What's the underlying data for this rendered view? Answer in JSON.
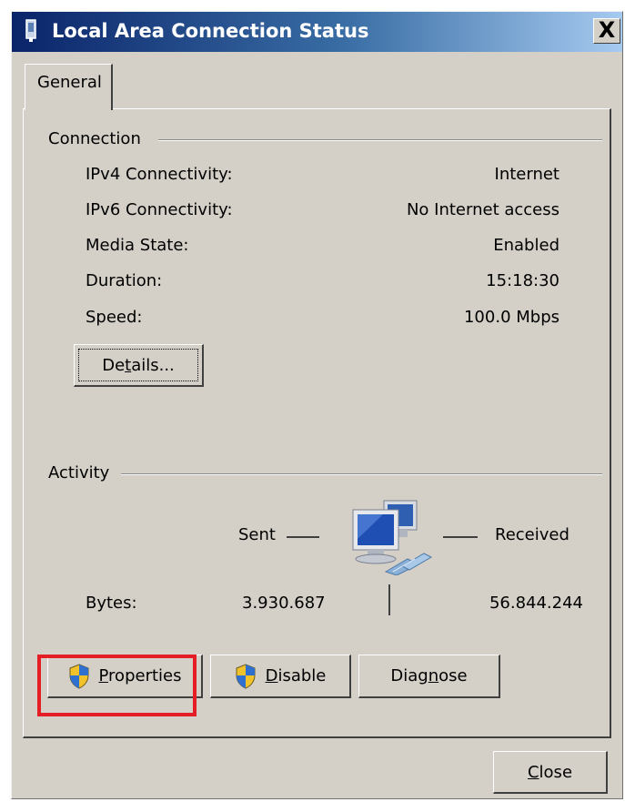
{
  "window": {
    "title": "Local Area Connection Status",
    "close_glyph": "X"
  },
  "tabs": [
    {
      "label": "General"
    }
  ],
  "connection": {
    "group_label": "Connection",
    "rows": [
      {
        "label": "IPv4 Connectivity:",
        "value": "Internet"
      },
      {
        "label": "IPv6 Connectivity:",
        "value": "No Internet access"
      },
      {
        "label": "Media State:",
        "value": "Enabled"
      },
      {
        "label": "Duration:",
        "value": "15:18:30"
      },
      {
        "label": "Speed:",
        "value": "100.0 Mbps"
      }
    ],
    "details_button": {
      "label_pre": "De",
      "label_mnemonic": "t",
      "label_post": "ails..."
    }
  },
  "activity": {
    "group_label": "Activity",
    "sent_label": "Sent",
    "received_label": "Received",
    "bytes_label": "Bytes:",
    "bytes_sent": "3.930.687",
    "bytes_received": "56.844.244"
  },
  "buttons": {
    "properties": {
      "mnemonic": "P",
      "rest": "roperties",
      "highlighted": true
    },
    "disable": {
      "mnemonic": "D",
      "rest": "isable"
    },
    "diagnose": {
      "pre": "Diag",
      "mnemonic": "n",
      "post": "ose"
    },
    "close": {
      "mnemonic": "C",
      "rest": "lose"
    }
  },
  "icons": {
    "app": "network-adapter-icon",
    "shield": "uac-shield-icon",
    "activity": "network-computers-icon"
  },
  "colors": {
    "title_start": "#0a246a",
    "title_end": "#a6caf0",
    "highlight": "#e51d24",
    "face": "#d4d0c8"
  }
}
